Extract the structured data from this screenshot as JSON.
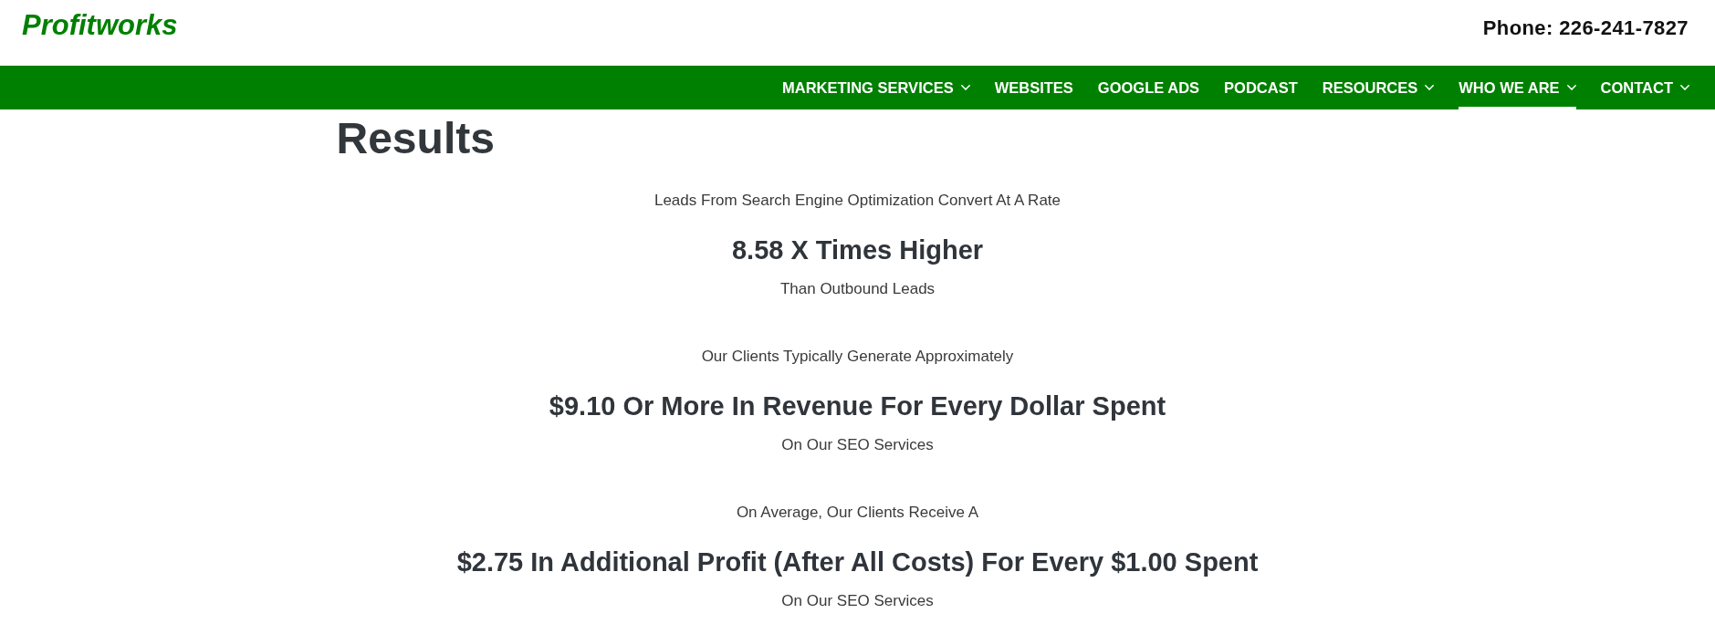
{
  "header": {
    "logo": "Profitworks",
    "phone": "Phone: 226-241-7827"
  },
  "nav": {
    "items": [
      {
        "label": "MARKETING SERVICES",
        "dropdown": true,
        "selected": false
      },
      {
        "label": "WEBSITES",
        "dropdown": false,
        "selected": false
      },
      {
        "label": "GOOGLE ADS",
        "dropdown": false,
        "selected": false
      },
      {
        "label": "PODCAST",
        "dropdown": false,
        "selected": false
      },
      {
        "label": "RESOURCES",
        "dropdown": true,
        "selected": false
      },
      {
        "label": "WHO WE ARE",
        "dropdown": true,
        "selected": true
      },
      {
        "label": "CONTACT",
        "dropdown": true,
        "selected": false
      }
    ]
  },
  "page": {
    "title": "Results",
    "stats": [
      {
        "intro": "Leads From Search Engine Optimization Convert At A Rate",
        "figure": "8.58 X Times Higher",
        "detail": "Than Outbound Leads"
      },
      {
        "intro": "Our Clients Typically Generate Approximately",
        "figure": "$9.10 Or More In Revenue For Every Dollar Spent",
        "detail": "On Our SEO Services"
      },
      {
        "intro": "On Average, Our Clients Receive A",
        "figure": "$2.75 In Additional Profit (After All Costs) For Every $1.00 Spent",
        "detail": "On Our SEO Services"
      }
    ]
  }
}
